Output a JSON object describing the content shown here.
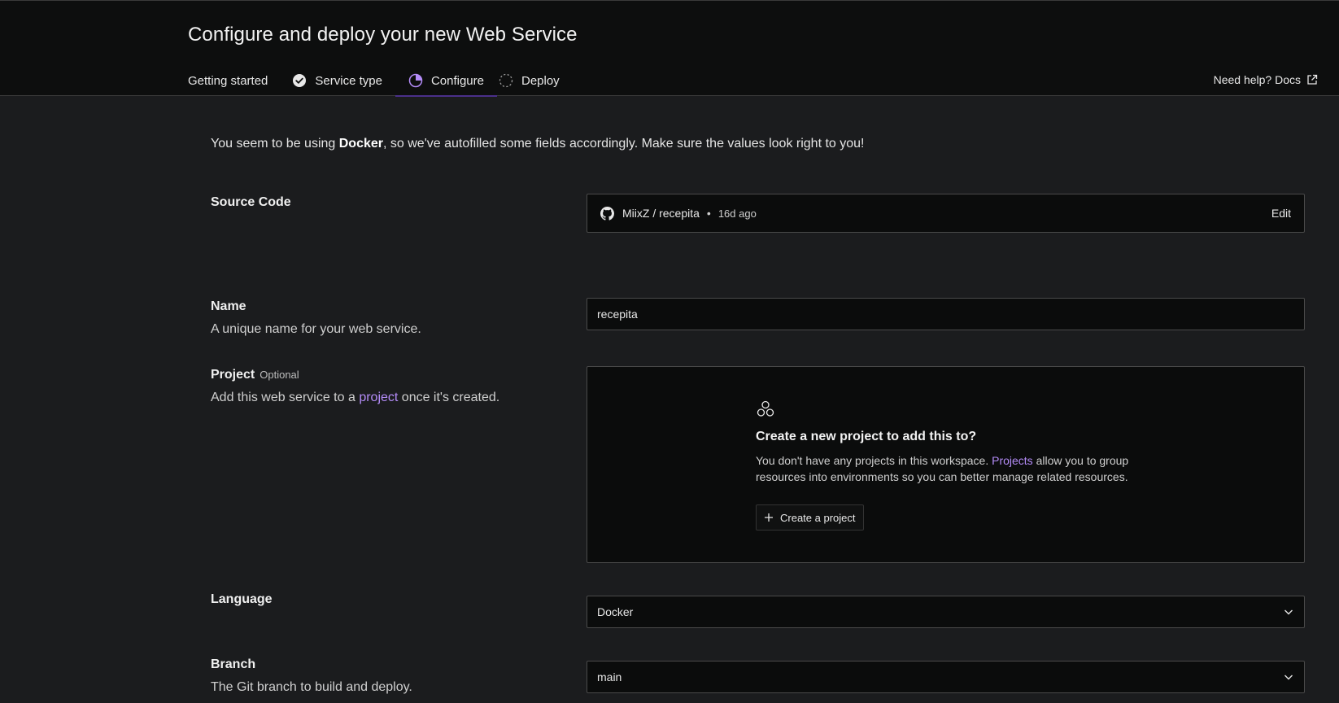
{
  "header": {
    "title": "Configure and deploy your new Web Service",
    "steps": [
      {
        "label": "Getting started",
        "state": "none"
      },
      {
        "label": "Service type",
        "state": "done"
      },
      {
        "label": "Configure",
        "state": "active"
      },
      {
        "label": "Deploy",
        "state": "pending"
      }
    ],
    "help_label": "Need help? Docs"
  },
  "notice": {
    "prefix": "You seem to be using ",
    "tech": "Docker",
    "suffix": ", so we've autofilled some fields accordingly. Make sure the values look right to you!"
  },
  "source_code": {
    "label": "Source Code",
    "repo": "MiixZ / recepita",
    "separator": "•",
    "updated": "16d ago",
    "edit_label": "Edit"
  },
  "name_field": {
    "label": "Name",
    "description": "A unique name for your web service.",
    "value": "recepita"
  },
  "project_field": {
    "label": "Project",
    "optional": "Optional",
    "desc_prefix": "Add this web service to a ",
    "desc_link": "project",
    "desc_suffix": " once it's created.",
    "empty_title": "Create a new project to add this to?",
    "empty_prefix": "You don't have any projects in this workspace. ",
    "empty_link": "Projects",
    "empty_suffix": " allow you to group resources into environments so you can better manage related resources.",
    "create_button": "Create a project"
  },
  "language_field": {
    "label": "Language",
    "value": "Docker"
  },
  "branch_field": {
    "label": "Branch",
    "description": "The Git branch to build and deploy.",
    "value": "main"
  },
  "colors": {
    "accent": "#b48cf8",
    "background": "#1b1c1e",
    "header_bg": "#0d0e0e"
  },
  "icons": [
    "check-circle-icon",
    "half-circle-icon",
    "dashed-circle-icon",
    "external-link-icon",
    "github-icon",
    "project-nodes-icon",
    "plus-icon",
    "chevron-down-icon"
  ]
}
